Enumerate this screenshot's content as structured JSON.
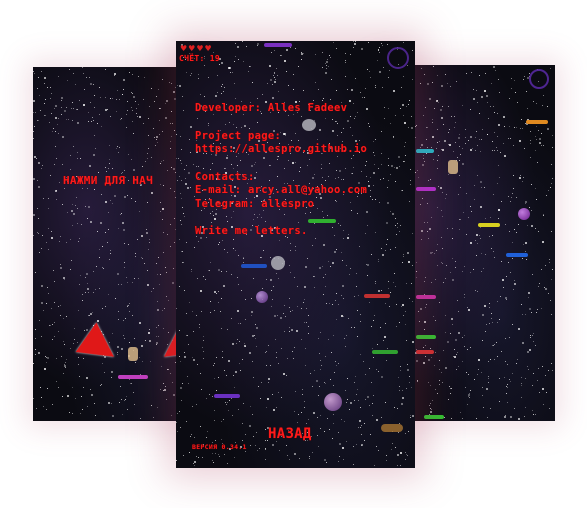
{
  "left_screen": {
    "tap_to_start": "НАЖМИ ДЛЯ НАЧ"
  },
  "center_screen": {
    "hud_score": "СЧЁТ: 19",
    "about_lines": [
      [
        "Developer: Alles Fadeev"
      ],
      [
        "Project page:",
        "https://allespro.github.io"
      ],
      [
        "Contacts:",
        "E-mail: arcy.all@yahoo.com",
        "Telegram: allespro"
      ],
      [
        "Write me letters."
      ]
    ],
    "back_label": "НАЗАД",
    "version_label": "ВЕРСИЯ 0.34.1"
  },
  "colors": {
    "text_red": "#ff1a1a",
    "background": "#0b0b12",
    "accent_purple": "#5a2aa8"
  }
}
